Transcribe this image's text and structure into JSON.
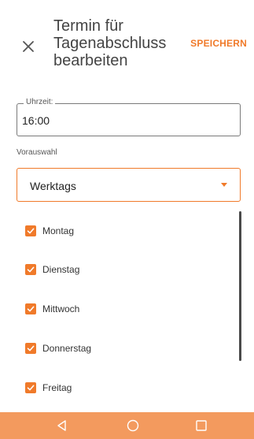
{
  "header": {
    "close_icon": "close-icon",
    "title_line1": "Termin für",
    "title_line2": "Tagenabschluss",
    "title_line3": "bearbeiten",
    "save_label": "SPEICHERN"
  },
  "time_field": {
    "label": "Uhrzeit:",
    "value": "16:00"
  },
  "preset": {
    "label": "Vorauswahl",
    "value": "Werktags",
    "arrow_icon": "dropdown-arrow-icon"
  },
  "days": [
    {
      "label": "Montag",
      "checked": true
    },
    {
      "label": "Dienstag",
      "checked": true
    },
    {
      "label": "Mittwoch",
      "checked": true
    },
    {
      "label": "Donnerstag",
      "checked": true
    },
    {
      "label": "Freitag",
      "checked": true
    }
  ],
  "navbar": {
    "back_icon": "back-icon",
    "home_icon": "home-icon",
    "recent_icon": "recent-apps-icon"
  },
  "colors": {
    "accent": "#f07a2a",
    "navbar": "#f39a5e",
    "text": "#333333"
  }
}
